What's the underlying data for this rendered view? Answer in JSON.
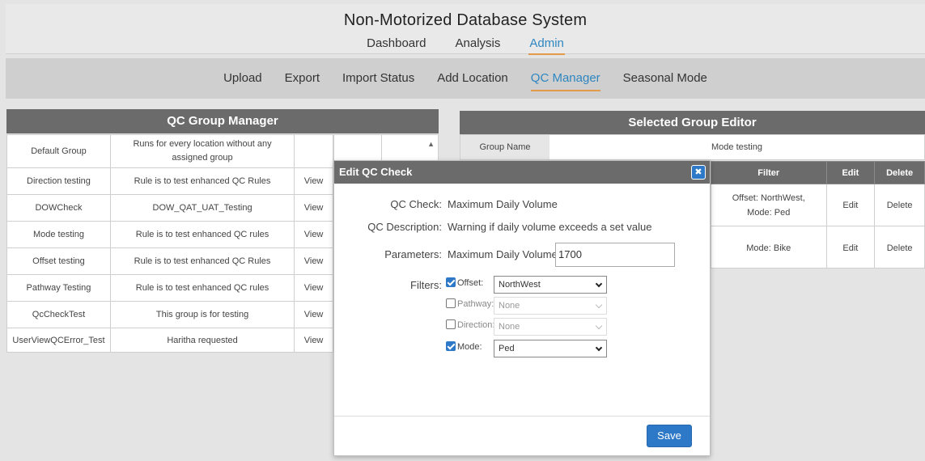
{
  "header": {
    "title": "Non-Motorized Database System",
    "nav": [
      "Dashboard",
      "Analysis",
      "Admin"
    ],
    "active_nav": "Admin"
  },
  "subnav": {
    "items": [
      "Upload",
      "Export",
      "Import Status",
      "Add Location",
      "QC Manager",
      "Seasonal Mode"
    ],
    "active": "QC Manager"
  },
  "group_manager": {
    "title": "QC Group Manager",
    "rows": [
      {
        "name": "Default Group",
        "description": "Runs for every location without any assigned group",
        "action": ""
      },
      {
        "name": "Direction testing",
        "description": "Rule is to test enhanced QC Rules",
        "action": "View"
      },
      {
        "name": "DOWCheck",
        "description": "DOW_QAT_UAT_Testing",
        "action": "View"
      },
      {
        "name": "Mode testing",
        "description": "Rule is to test enhanced QC rules",
        "action": "View"
      },
      {
        "name": "Offset testing",
        "description": "Rule is to test enhanced QC Rules",
        "action": "View"
      },
      {
        "name": "Pathway Testing",
        "description": "Rule is to test enhanced QC rules",
        "action": "View"
      },
      {
        "name": "QcCheckTest",
        "description": "This group is for testing",
        "action": "View"
      },
      {
        "name": "UserViewQCError_Test",
        "description": "Haritha requested",
        "action": "View"
      }
    ]
  },
  "group_editor": {
    "title": "Selected Group Editor",
    "group_name_label": "Group Name",
    "group_name_value": "Mode testing",
    "columns": [
      "Filter",
      "Edit",
      "Delete"
    ],
    "rows": [
      {
        "filter": "Offset: NorthWest, Mode: Ped",
        "edit": "Edit",
        "delete": "Delete"
      },
      {
        "filter": "Mode: Bike",
        "edit": "Edit",
        "delete": "Delete"
      }
    ]
  },
  "modal": {
    "title": "Edit QC Check",
    "close_icon": "close-icon",
    "qc_check_label": "QC Check:",
    "qc_check_value": "Maximum Daily Volume",
    "qc_description_label": "QC Description:",
    "qc_description_value": "Warning if daily volume exceeds a set value",
    "parameters_label": "Parameters:",
    "parameter_name": "Maximum Daily Volume",
    "parameter_value": "1700",
    "filters_label": "Filters:",
    "filters": [
      {
        "label": "Offset:",
        "checked": true,
        "value": "NorthWest",
        "disabled": false
      },
      {
        "label": "Pathway:",
        "checked": false,
        "value": "None",
        "disabled": true
      },
      {
        "label": "Direction:",
        "checked": false,
        "value": "None",
        "disabled": true
      },
      {
        "label": "Mode:",
        "checked": true,
        "value": "Ped",
        "disabled": false
      }
    ],
    "save_label": "Save"
  },
  "colors": {
    "accent": "#2e86c1",
    "underline": "#e39a4a",
    "panel_header": "#6b6b6b",
    "button": "#2e79c7"
  }
}
